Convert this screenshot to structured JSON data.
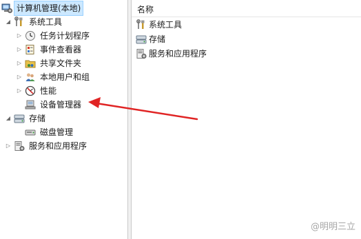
{
  "tree": {
    "root": "计算机管理(本地)",
    "system_tools": "系统工具",
    "task_scheduler": "任务计划程序",
    "event_viewer": "事件查看器",
    "shared_folders": "共享文件夹",
    "local_users": "本地用户和组",
    "performance": "性能",
    "device_manager": "设备管理器",
    "storage": "存储",
    "disk_management": "磁盘管理",
    "services_apps": "服务和应用程序"
  },
  "list": {
    "column_name": "名称",
    "items": [
      "系统工具",
      "存储",
      "服务和应用程序"
    ]
  },
  "watermark": "@明明三立",
  "colors": {
    "selection": "#cce8ff",
    "annotation_arrow": "#e02424"
  }
}
